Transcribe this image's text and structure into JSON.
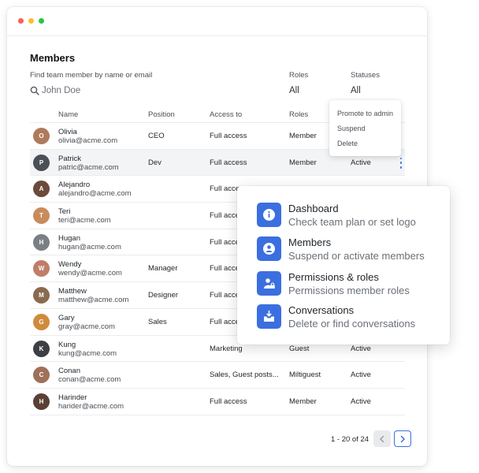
{
  "window": {
    "controls": [
      "close",
      "minimize",
      "maximize"
    ]
  },
  "header": {
    "title": "Members"
  },
  "filters": {
    "search_label": "Find team member by name or email",
    "search_placeholder": "John Doe",
    "roles_label": "Roles",
    "roles_value": "All",
    "statuses_label": "Statuses",
    "statuses_value": "All"
  },
  "table": {
    "columns": [
      "Name",
      "Position",
      "Access to",
      "Roles",
      "Statuses"
    ],
    "rows": [
      {
        "name": "Olivia",
        "email": "olivia@acme.com",
        "position": "CEO",
        "access": "Full access",
        "role": "Member",
        "status": "",
        "initials": "O",
        "avatar_color": "#b07a5c"
      },
      {
        "name": "Patrick",
        "email": "patric@acme.com",
        "position": "Dev",
        "access": "Full access",
        "role": "Member",
        "status": "Active",
        "initials": "P",
        "avatar_color": "#4b4f57"
      },
      {
        "name": "Alejandro",
        "email": "alejandro@acme.com",
        "position": "",
        "access": "Full access",
        "role": "",
        "status": "",
        "initials": "A",
        "avatar_color": "#6b4a3a"
      },
      {
        "name": "Teri",
        "email": "teri@acme.com",
        "position": "",
        "access": "Full access",
        "role": "",
        "status": "",
        "initials": "T",
        "avatar_color": "#c98b5a"
      },
      {
        "name": "Hugan",
        "email": "hugan@acme.com",
        "position": "",
        "access": "Full access",
        "role": "",
        "status": "",
        "initials": "H",
        "avatar_color": "#7a7f86"
      },
      {
        "name": "Wendy",
        "email": "wendy@acme.com",
        "position": "Manager",
        "access": "Full access",
        "role": "",
        "status": "",
        "initials": "W",
        "avatar_color": "#c07d68"
      },
      {
        "name": "Matthew",
        "email": "matthew@acme.com",
        "position": "Designer",
        "access": "Full access",
        "role": "",
        "status": "",
        "initials": "M",
        "avatar_color": "#8a6a4f"
      },
      {
        "name": "Gary",
        "email": "gray@acme.com",
        "position": "Sales",
        "access": "Full access",
        "role": "",
        "status": "",
        "initials": "G",
        "avatar_color": "#d08a3c"
      },
      {
        "name": "Kung",
        "email": "kung@acme.com",
        "position": "",
        "access": "Marketing",
        "role": "Guest",
        "status": "Active",
        "initials": "K",
        "avatar_color": "#3d3f44"
      },
      {
        "name": "Conan",
        "email": "conan@acme.com",
        "position": "",
        "access": "Sales, Guest posts...",
        "role": "Miltiguest",
        "status": "Active",
        "initials": "C",
        "avatar_color": "#a0705a"
      },
      {
        "name": "Harinder",
        "email": "harider@acme.com",
        "position": "",
        "access": "Full access",
        "role": "Member",
        "status": "Active",
        "initials": "H",
        "avatar_color": "#5a4034"
      }
    ]
  },
  "context_menu": {
    "items": [
      "Promote to admin",
      "Suspend",
      "Delete"
    ]
  },
  "pagination": {
    "label": "1 - 20 of 24",
    "prev_icon": "chevron-left-icon",
    "next_icon": "chevron-right-icon"
  },
  "popover": {
    "items": [
      {
        "title": "Dashboard",
        "description": "Check team plan or set logo",
        "icon": "info-icon"
      },
      {
        "title": "Members",
        "description": "Suspend or activate members",
        "icon": "user-icon"
      },
      {
        "title": "Permissions & roles",
        "description": "Permissions member roles",
        "icon": "user-lock-icon"
      },
      {
        "title": "Conversations",
        "description": "Delete or find conversations",
        "icon": "inbox-download-icon"
      }
    ]
  },
  "colors": {
    "accent": "#3b6fe0",
    "row_highlight": "#f3f4f6"
  }
}
